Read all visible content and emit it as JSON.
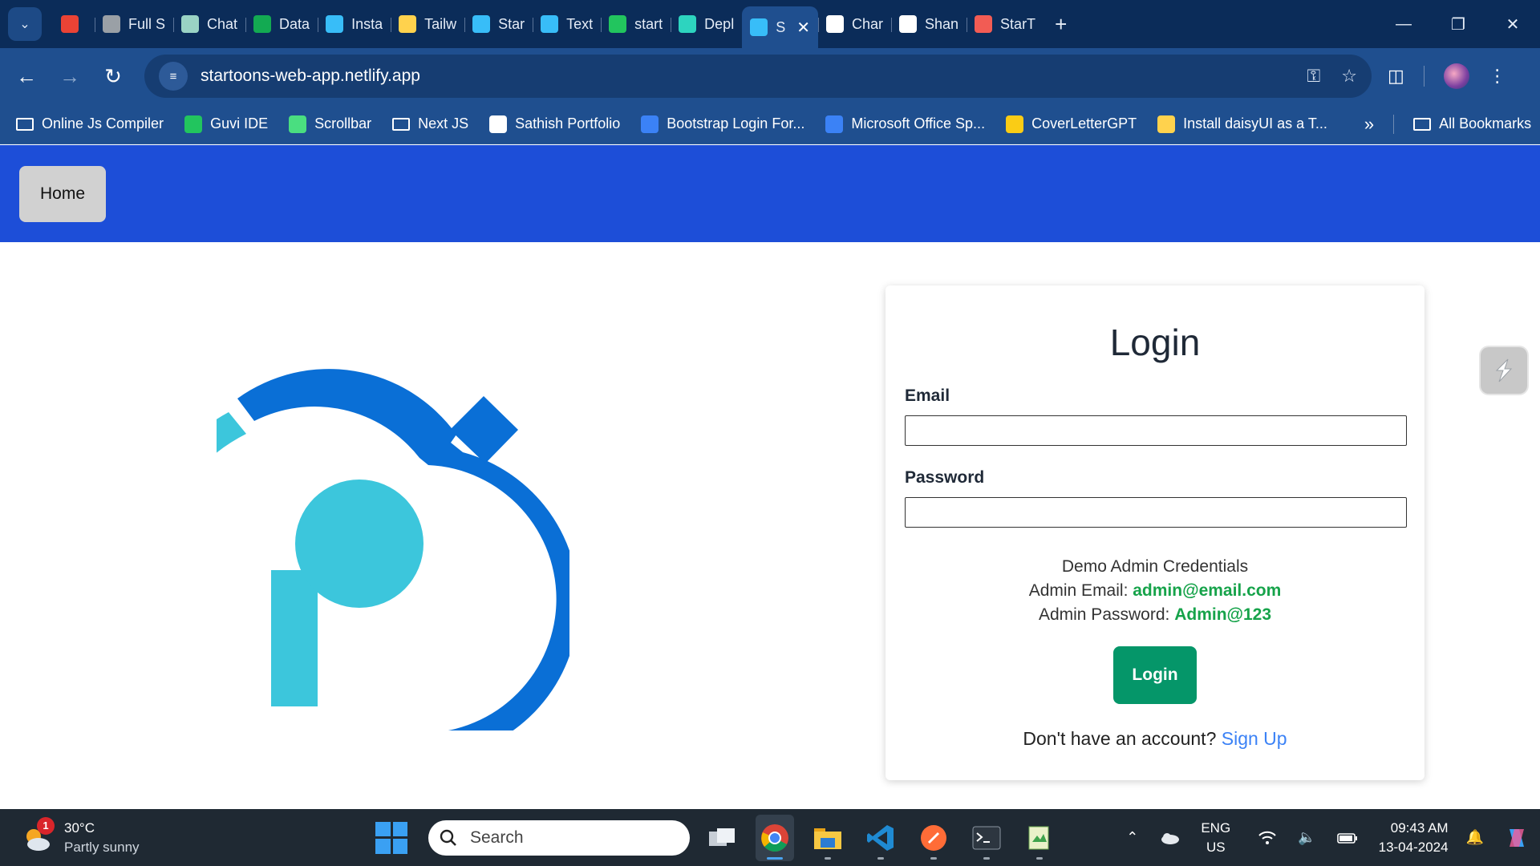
{
  "browser": {
    "tabs": [
      {
        "label": "",
        "icon": "gmail-icon",
        "color": "#ea4335"
      },
      {
        "label": "Full S",
        "icon": "globe-icon",
        "color": "#9aa0a6"
      },
      {
        "label": "Chat",
        "icon": "chatgpt-icon",
        "color": "#9ad3c4"
      },
      {
        "label": "Data",
        "icon": "mongodb-icon",
        "color": "#13aa52"
      },
      {
        "label": "Insta",
        "icon": "tailwind-icon",
        "color": "#38bdf8"
      },
      {
        "label": "Tailw",
        "icon": "daisyui-icon",
        "color": "#ffd24d"
      },
      {
        "label": "Star",
        "icon": "startoons-icon",
        "color": "#38bdf8"
      },
      {
        "label": "Text",
        "icon": "tailwind-icon",
        "color": "#38bdf8"
      },
      {
        "label": "start",
        "icon": "netlify-check-icon",
        "color": "#22c55e"
      },
      {
        "label": "Depl",
        "icon": "netlify-icon",
        "color": "#2dd4bf"
      },
      {
        "label": "S",
        "icon": "startoons-icon",
        "color": "#38bdf8",
        "active": true
      },
      {
        "label": "Char",
        "icon": "chart-icon",
        "color": "#ffffff"
      },
      {
        "label": "Shan",
        "icon": "github-icon",
        "color": "#ffffff"
      },
      {
        "label": "StarT",
        "icon": "app-icon",
        "color": "#f25c54"
      }
    ],
    "url": "startoons-web-app.netlify.app",
    "bookmarks": [
      {
        "label": "Online Js Compiler",
        "icon": "folder-icon"
      },
      {
        "label": "Guvi IDE",
        "icon": "guvi-icon",
        "color": "#22c55e"
      },
      {
        "label": "Scrollbar",
        "icon": "scrollbar-icon",
        "color": "#4ade80"
      },
      {
        "label": "Next JS",
        "icon": "folder-icon"
      },
      {
        "label": "Sathish Portfolio",
        "icon": "portfolio-icon",
        "color": "#ffffff"
      },
      {
        "label": "Bootstrap Login For...",
        "icon": "mdb-icon",
        "color": "#3b82f6"
      },
      {
        "label": "Microsoft Office Sp...",
        "icon": "p-icon",
        "color": "#3b82f6"
      },
      {
        "label": "CoverLetterGPT",
        "icon": "coverletter-icon",
        "color": "#facc15"
      },
      {
        "label": "Install daisyUI as a T...",
        "icon": "daisyui-icon",
        "color": "#ffd24d"
      }
    ],
    "all_bookmarks": "All Bookmarks"
  },
  "app": {
    "nav": {
      "home": "Home"
    },
    "login": {
      "title": "Login",
      "email_label": "Email",
      "email_value": "",
      "password_label": "Password",
      "password_value": "",
      "demo_heading": "Demo Admin Credentials",
      "admin_email_label": "Admin Email:",
      "admin_email": "admin@email.com",
      "admin_password_label": "Admin Password:",
      "admin_password": "Admin@123",
      "button": "Login",
      "signup_prompt": "Don't have an account?",
      "signup_link": "Sign Up"
    },
    "colors": {
      "nav": "#1d4ed8",
      "button": "#059669",
      "credential": "#16a34a",
      "link": "#3b82f6",
      "logo_dark": "#0a6fd6",
      "logo_light": "#3cc6dc"
    }
  },
  "taskbar": {
    "weather_temp": "30°C",
    "weather_cond": "Partly sunny",
    "weather_badge": "1",
    "search": "Search",
    "lang_top": "ENG",
    "lang_bottom": "US",
    "time": "09:43 AM",
    "date": "13-04-2024"
  }
}
